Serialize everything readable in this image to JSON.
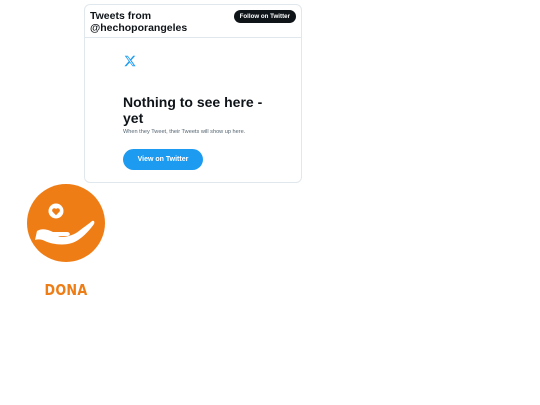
{
  "twitter_embed": {
    "title": "Tweets from @hechoporangeles",
    "follow_label": "Follow on Twitter",
    "empty_title": "Nothing to see here - yet",
    "empty_subtitle": "When they Tweet, their Tweets will show up here.",
    "view_label": "View on Twitter",
    "icon": "x-logo-icon",
    "colors": {
      "button": "#1d9bf0",
      "text": "#0f1419",
      "follow_bg": "#0f1419"
    }
  },
  "donate": {
    "label": "DONA",
    "icon": "hand-heart-icon",
    "colors": {
      "accent": "#ef7d16"
    }
  }
}
